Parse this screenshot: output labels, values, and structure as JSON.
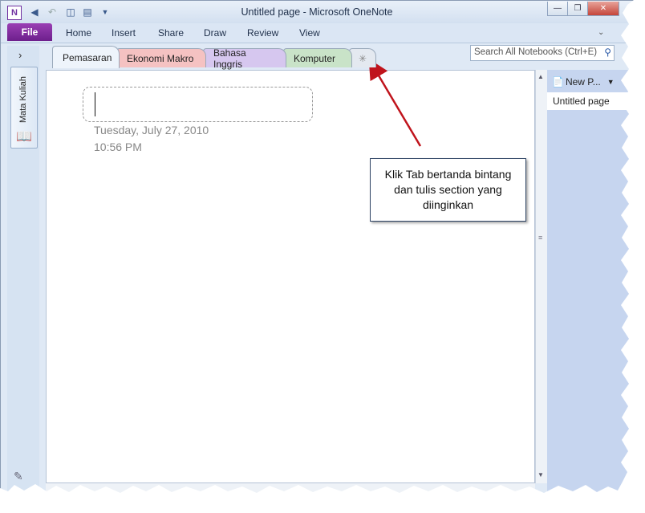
{
  "window": {
    "title": "Untitled page  -  Microsoft OneNote",
    "app_icon": "N",
    "controls": [
      "minimize-icon",
      "restore-icon",
      "close-icon"
    ]
  },
  "ribbon": {
    "file_label": "File",
    "tabs": [
      "Home",
      "Insert",
      "Share",
      "Draw",
      "Review",
      "View"
    ]
  },
  "notebook": {
    "name": "Mata Kuliah"
  },
  "sections": [
    {
      "label": "Pemasaran",
      "color": "#eef4fb"
    },
    {
      "label": "Ekonomi Makro",
      "color": "#f5c2c2"
    },
    {
      "label": "Bahasa Inggris",
      "color": "#d6c7ef"
    },
    {
      "label": "Komputer",
      "color": "#c9e3c8"
    }
  ],
  "search": {
    "placeholder": "Search All Notebooks (Ctrl+E)"
  },
  "page": {
    "date": "Tuesday, July 27, 2010",
    "time": "10:56 PM"
  },
  "pages_pane": {
    "new_page_label": "New P...",
    "items": [
      "Untitled page"
    ]
  },
  "callout": {
    "text": "Klik Tab bertanda bintang dan tulis section yang diinginkan"
  }
}
